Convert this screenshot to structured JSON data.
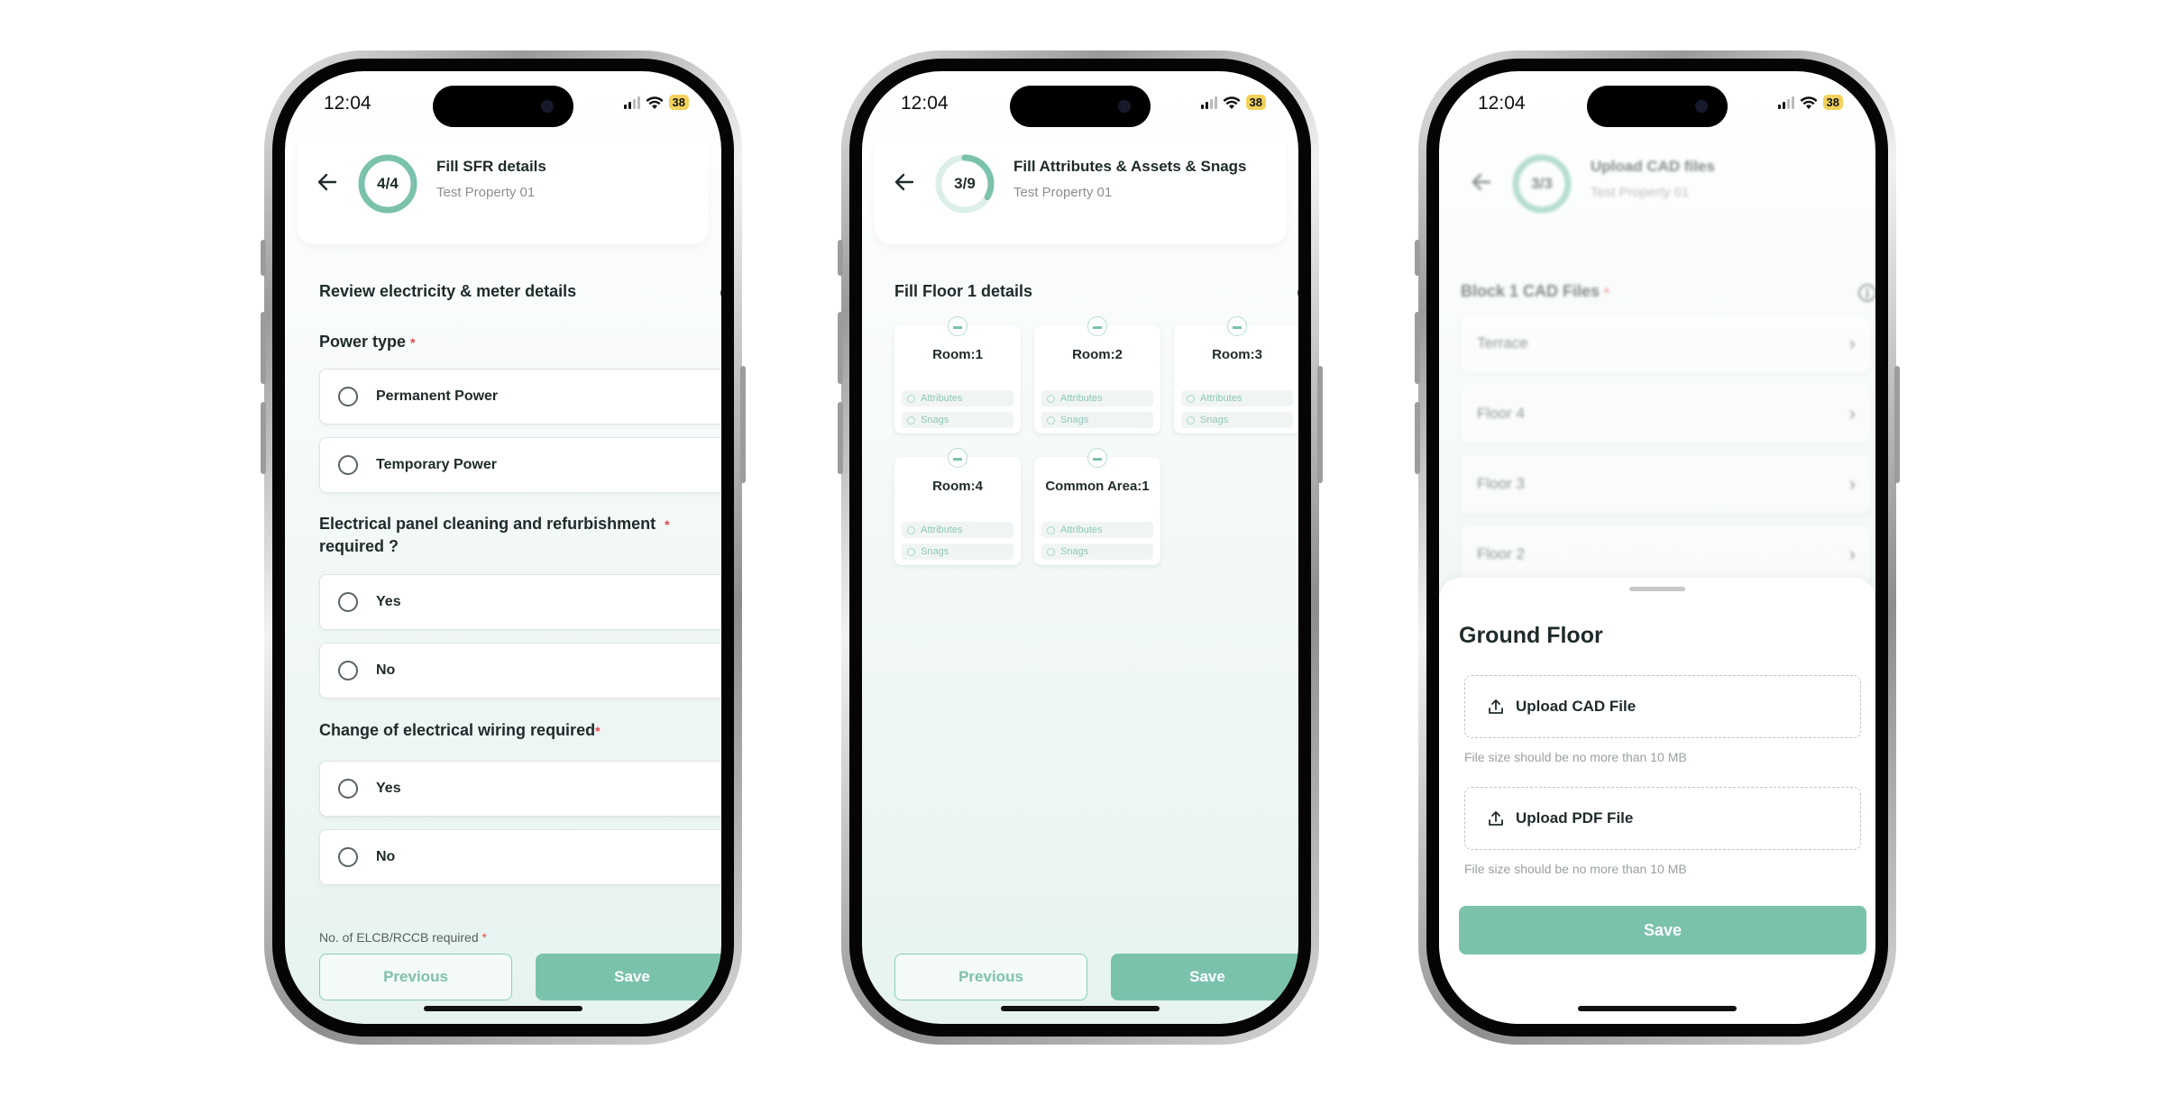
{
  "colors": {
    "accent": "#7bc2ad",
    "required": "#e0474c",
    "battery": "#f3d25b"
  },
  "status_bar": {
    "time": "12:04",
    "battery": "38"
  },
  "screens": [
    {
      "header": {
        "progress": "4/4",
        "progress_fraction": 1.0,
        "title": "Fill SFR details",
        "subtitle": "Test Property 01"
      },
      "section_title": "Review electricity & meter details",
      "questions": [
        {
          "label": "Power type",
          "required": "*",
          "options": [
            "Permanent Power",
            "Temporary Power"
          ]
        },
        {
          "label_line1": "Electrical panel cleaning and refurbishment",
          "label_line2": "required ?",
          "required": "*",
          "options": [
            "Yes",
            "No"
          ]
        },
        {
          "label": "Change of electrical wiring required",
          "required": "*",
          "options": [
            "Yes",
            "No"
          ]
        }
      ],
      "partial_label": "No. of ELCB/RCCB required",
      "partial_required": "*",
      "buttons": {
        "previous": "Previous",
        "save": "Save"
      }
    },
    {
      "header": {
        "progress": "3/9",
        "progress_fraction": 0.333,
        "title": "Fill Attributes & Assets & Snags",
        "subtitle": "Test Property 01"
      },
      "section_title": "Fill Floor 1 details",
      "rooms": [
        {
          "name": "Room:1",
          "attributes": "Attributes",
          "snags": "Snags"
        },
        {
          "name": "Room:2",
          "attributes": "Attributes",
          "snags": "Snags"
        },
        {
          "name": "Room:3",
          "attributes": "Attributes",
          "snags": "Snags"
        },
        {
          "name": "Room:4",
          "attributes": "Attributes",
          "snags": "Snags"
        },
        {
          "name": "Common Area:1",
          "attributes": "Attributes",
          "snags": "Snags"
        }
      ],
      "buttons": {
        "previous": "Previous",
        "save": "Save"
      }
    },
    {
      "header": {
        "progress": "3/3",
        "progress_fraction": 1.0,
        "title": "Upload CAD files",
        "subtitle": "Test Property 01"
      },
      "section_title": "Block 1 CAD Files",
      "section_required": "*",
      "floors": [
        "Terrace",
        "Floor 4",
        "Floor 3",
        "Floor 2"
      ],
      "sheet": {
        "title": "Ground Floor",
        "upload_cad": "Upload CAD File",
        "upload_pdf": "Upload PDF File",
        "hint": "File size should be no more than 10 MB",
        "save": "Save"
      }
    }
  ]
}
